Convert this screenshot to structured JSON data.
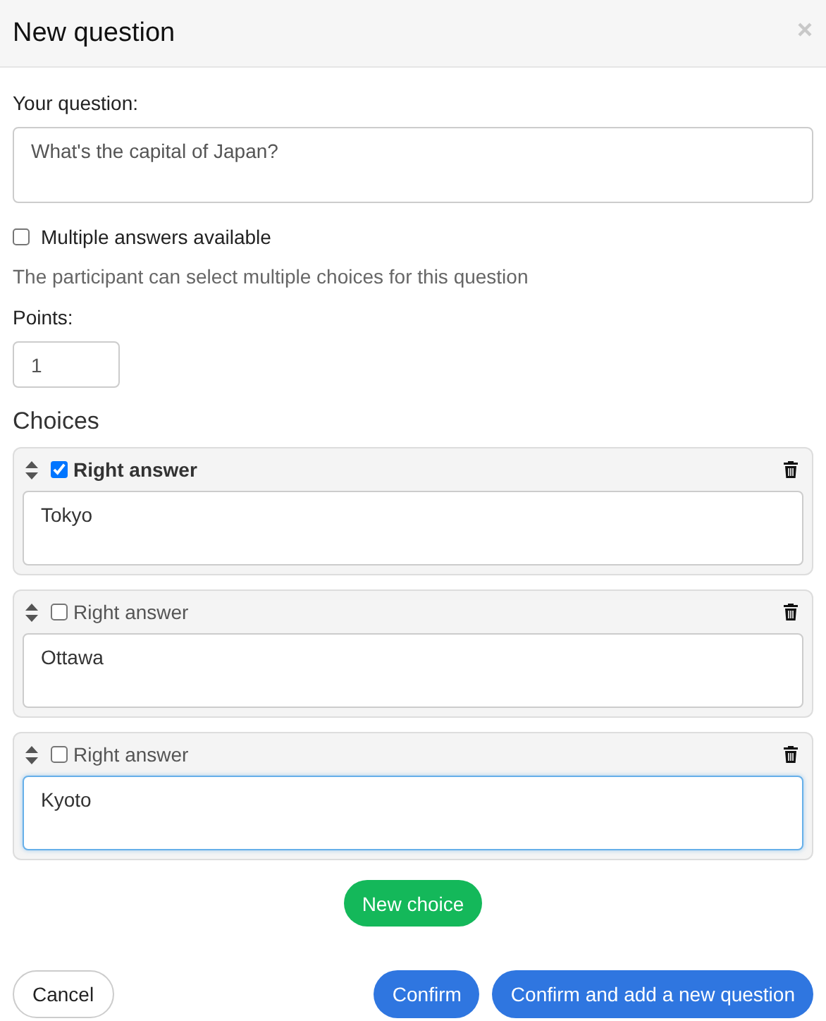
{
  "dialog": {
    "title": "New question"
  },
  "question": {
    "label": "Your question:",
    "value": "What's the capital of Japan?"
  },
  "multiple": {
    "label": "Multiple answers available",
    "checked": false,
    "help": "The participant can select multiple choices for this question"
  },
  "points": {
    "label": "Points:",
    "value": "1"
  },
  "choices_heading": "Choices",
  "choices": [
    {
      "label": "Right answer",
      "checked": true,
      "value": "Tokyo",
      "focused": false
    },
    {
      "label": "Right answer",
      "checked": false,
      "value": "Ottawa",
      "focused": false
    },
    {
      "label": "Right answer",
      "checked": false,
      "value": "Kyoto",
      "focused": true
    }
  ],
  "new_choice": "New choice",
  "buttons": [
    {
      "label": "Cancel",
      "kind": "secondary"
    },
    {
      "label": "Confirm",
      "kind": "primary"
    },
    {
      "label": "Confirm and add a new question",
      "kind": "primary"
    }
  ]
}
